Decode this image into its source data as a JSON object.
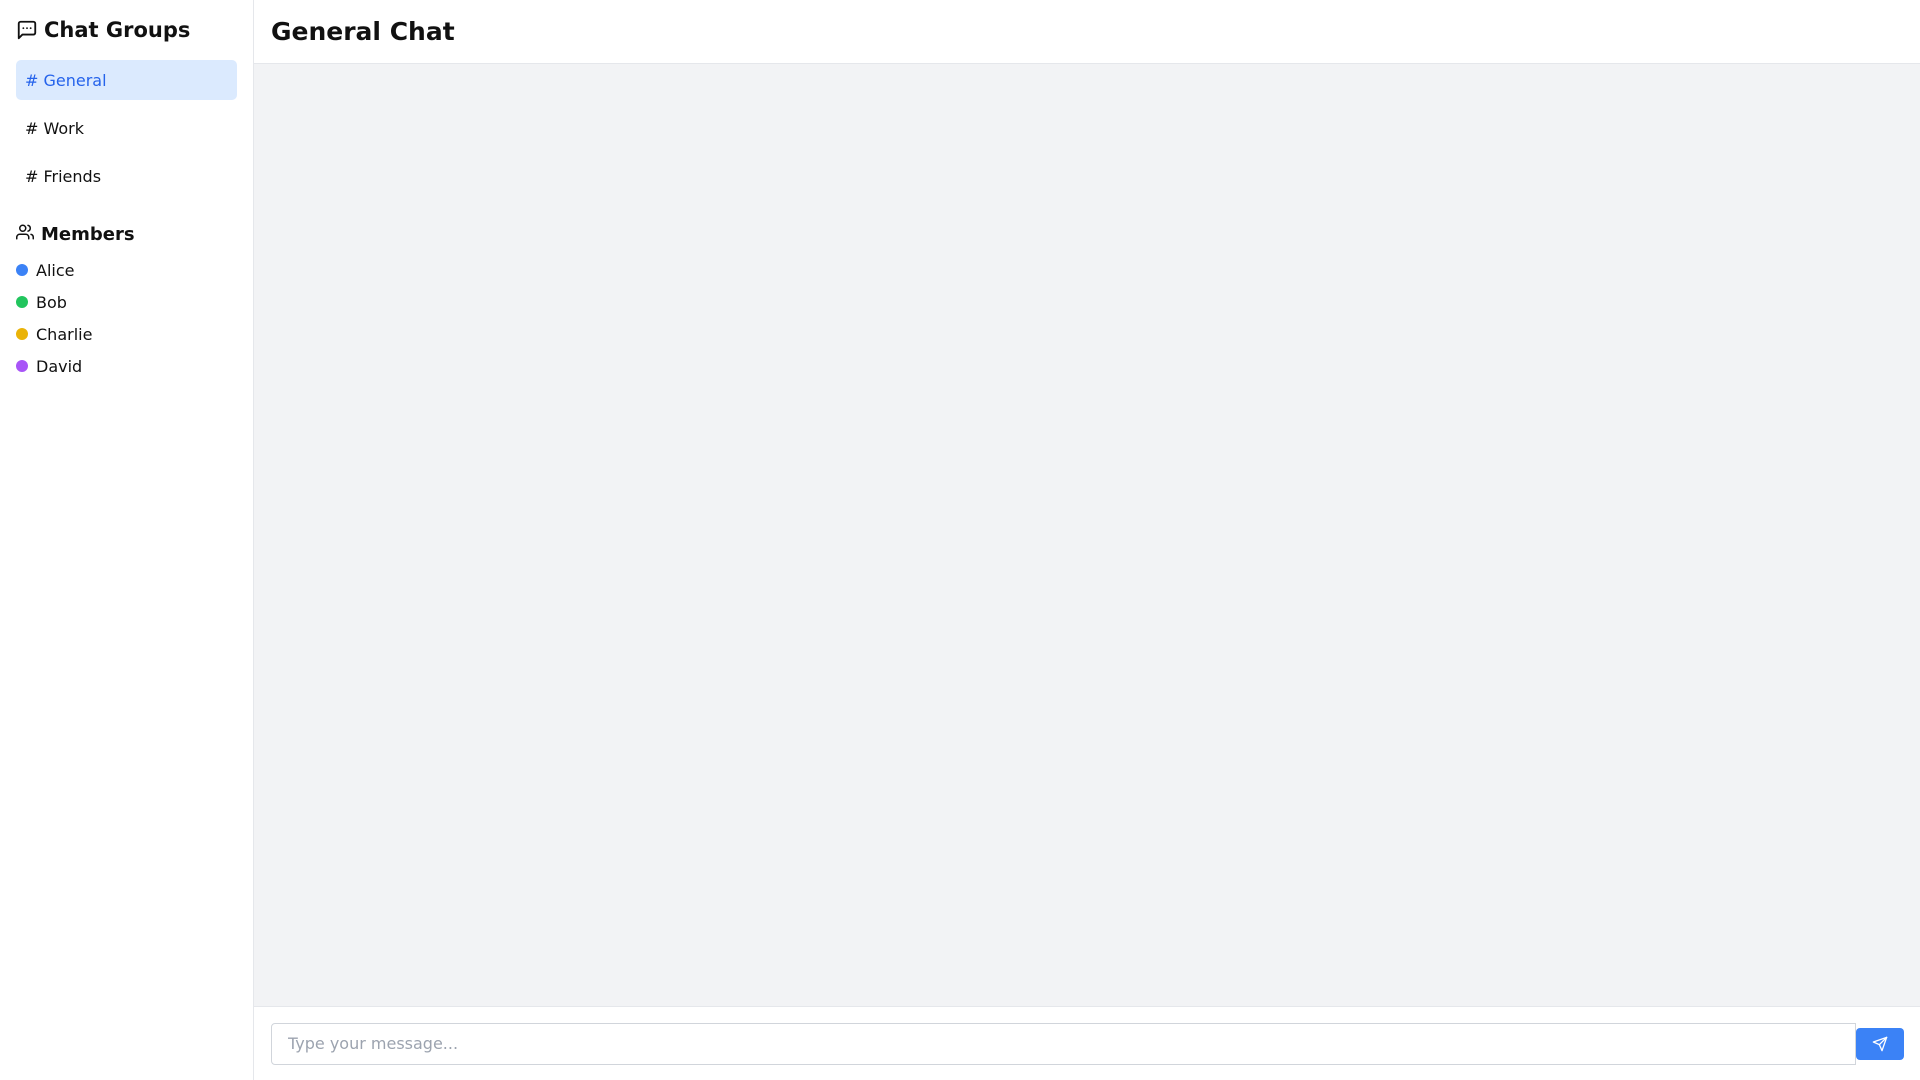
{
  "sidebar": {
    "title": "Chat Groups",
    "title_icon": "chat-bubble-icon",
    "channels": [
      {
        "label": "# General",
        "active": true
      },
      {
        "label": "# Work",
        "active": false
      },
      {
        "label": "# Friends",
        "active": false
      }
    ],
    "members_title": "Members",
    "members_icon": "users-icon",
    "members": [
      {
        "name": "Alice",
        "color": "#3b82f6"
      },
      {
        "name": "Bob",
        "color": "#22c55e"
      },
      {
        "name": "Charlie",
        "color": "#eab308"
      },
      {
        "name": "David",
        "color": "#a855f7"
      }
    ]
  },
  "main": {
    "title": "General Chat"
  },
  "composer": {
    "placeholder": "Type your message...",
    "value": "",
    "send_icon": "send-icon"
  },
  "colors": {
    "accent": "#3b82f6",
    "active_bg": "#dbeafe",
    "active_text": "#2563eb",
    "messages_bg": "#f2f3f5"
  }
}
